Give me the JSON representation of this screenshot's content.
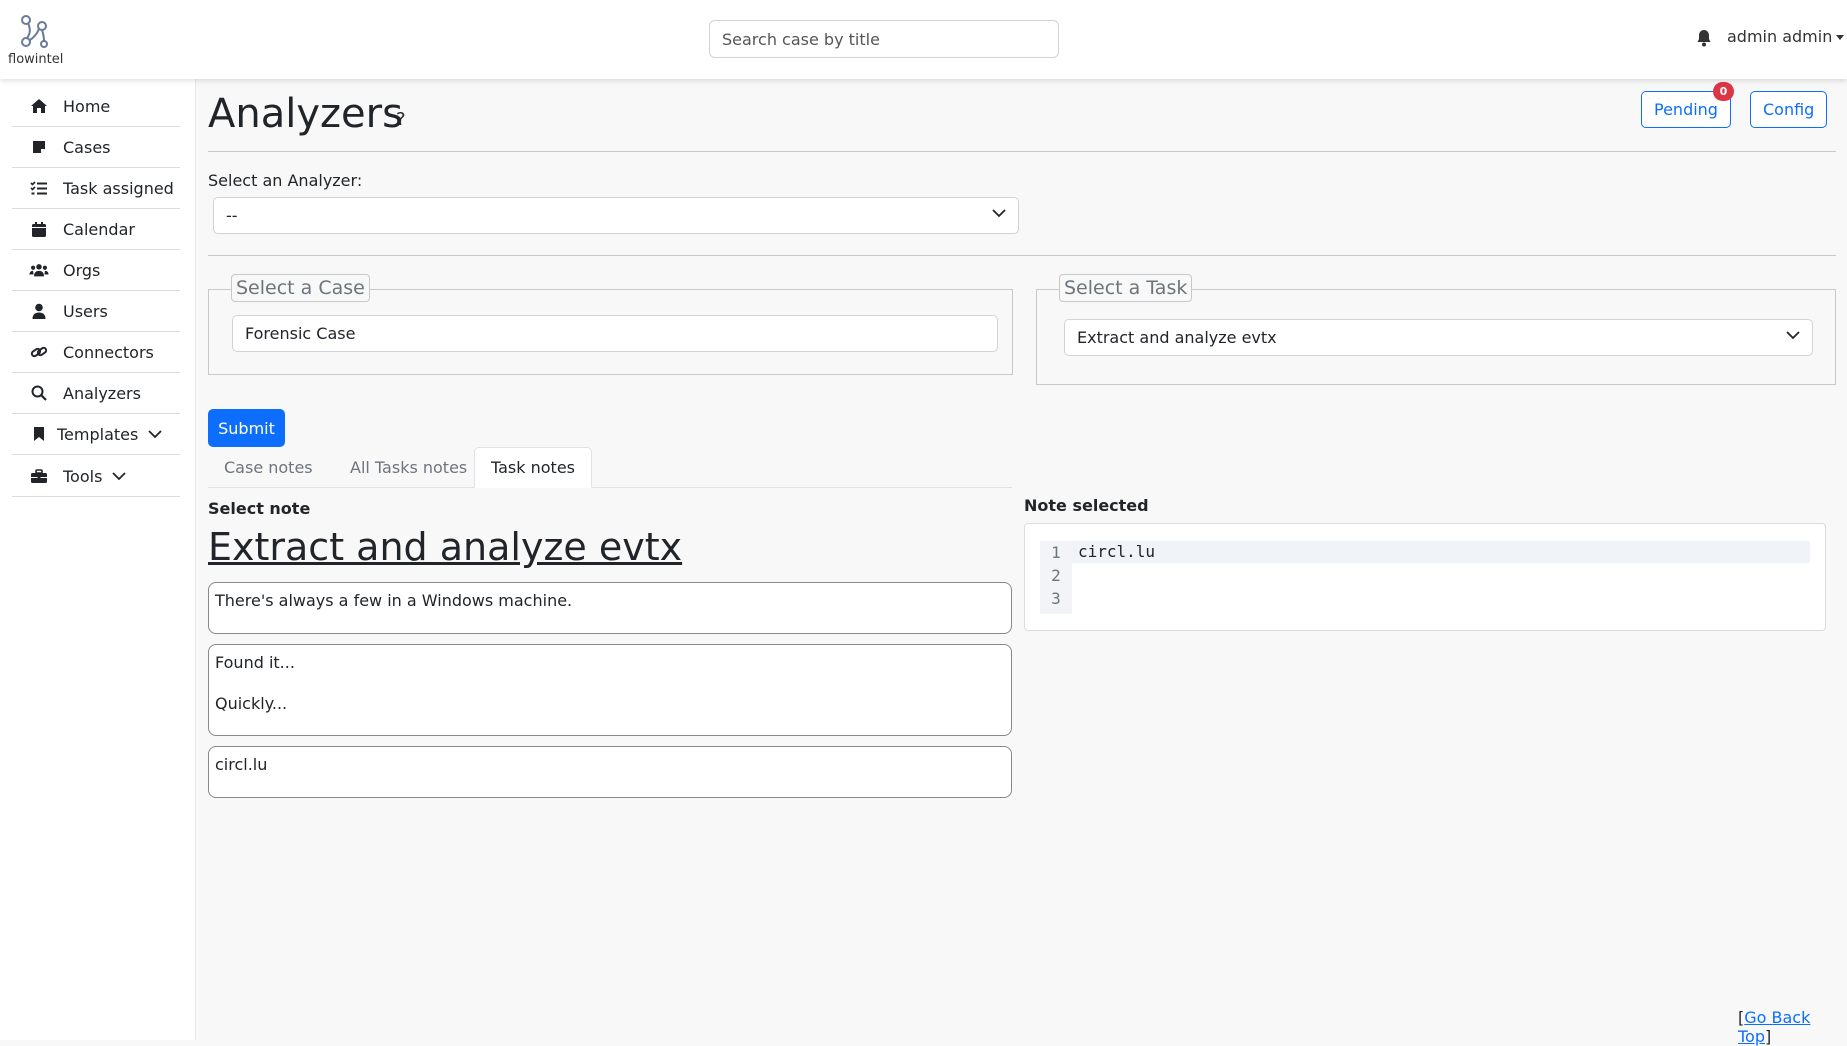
{
  "app": {
    "logo_text": "flowintel"
  },
  "header": {
    "search_placeholder": "Search case by title",
    "user": "admin admin"
  },
  "sidebar": {
    "items": [
      {
        "label": "Home"
      },
      {
        "label": "Cases"
      },
      {
        "label": "Task assigned"
      },
      {
        "label": "Calendar"
      },
      {
        "label": "Orgs"
      },
      {
        "label": "Users"
      },
      {
        "label": "Connectors"
      },
      {
        "label": "Analyzers"
      },
      {
        "label": "Templates"
      },
      {
        "label": "Tools"
      }
    ]
  },
  "page": {
    "title": "Analyzers",
    "help": "?",
    "pending_label": "Pending",
    "pending_count": "0",
    "config_label": "Config"
  },
  "analyzer": {
    "label": "Select an Analyzer:",
    "selected": "--"
  },
  "case_select": {
    "legend": "Select a Case",
    "value": "Forensic Case"
  },
  "task_select": {
    "legend": "Select a Task",
    "value": "Extract and analyze evtx"
  },
  "submit_label": "Submit",
  "tabs": [
    {
      "label": "Case notes"
    },
    {
      "label": "All Tasks notes"
    },
    {
      "label": "Task notes"
    }
  ],
  "notes": {
    "select_label": "Select note",
    "task_title": "Extract and analyze evtx",
    "items": [
      {
        "lines": [
          "There's always a few in a Windows machine."
        ]
      },
      {
        "lines": [
          "Found it...",
          "Quickly..."
        ]
      },
      {
        "lines": [
          "circl.lu"
        ]
      }
    ]
  },
  "selected_note": {
    "label": "Note selected",
    "line_numbers": [
      "1",
      "2",
      "3"
    ],
    "code_line_1": "circl.lu"
  },
  "footer": {
    "bracket_open": "[",
    "go_back": "Go Back Top",
    "bracket_close": "]"
  }
}
